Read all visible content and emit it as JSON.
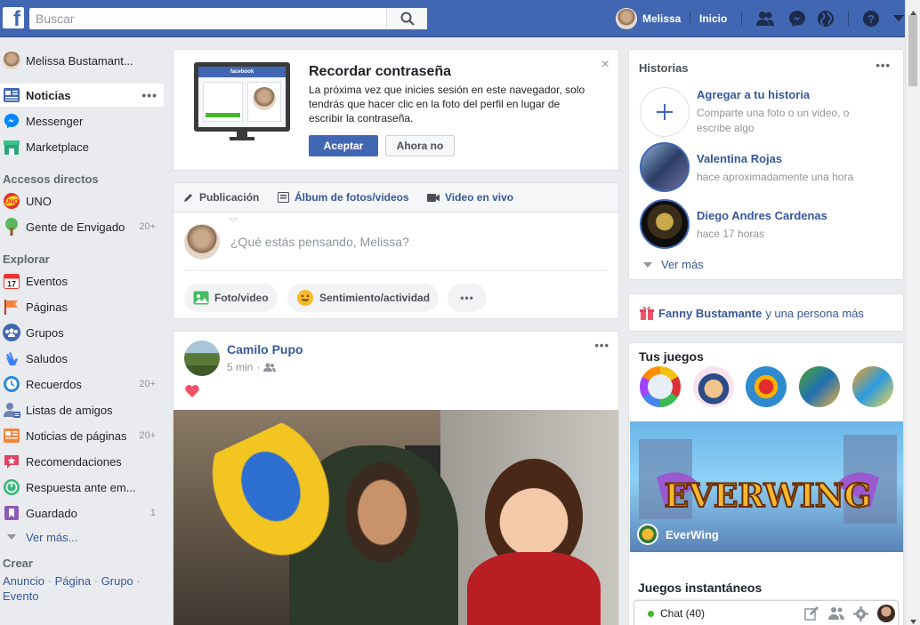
{
  "topbar": {
    "search_placeholder": "Buscar",
    "user_name": "Melissa",
    "home_label": "Inicio",
    "logo_letter": "f"
  },
  "sidebar": {
    "profile_name": "Melissa Bustamant...",
    "main_items": [
      {
        "label": "Noticias",
        "icon": "news-feed-icon"
      },
      {
        "label": "Messenger",
        "icon": "messenger-icon"
      },
      {
        "label": "Marketplace",
        "icon": "marketplace-icon"
      }
    ],
    "shortcuts_heading": "Accesos directos",
    "shortcuts": [
      {
        "label": "UNO",
        "icon": "uno-icon"
      },
      {
        "label": "Gente de Envigado",
        "count": "20+",
        "icon": "tree-icon"
      }
    ],
    "explore_heading": "Explorar",
    "explore": [
      {
        "label": "Eventos",
        "icon": "calendar-icon"
      },
      {
        "label": "Páginas",
        "icon": "flag-icon"
      },
      {
        "label": "Grupos",
        "icon": "groups-icon"
      },
      {
        "label": "Saludos",
        "icon": "wave-icon"
      },
      {
        "label": "Recuerdos",
        "count": "20+",
        "icon": "memories-icon"
      },
      {
        "label": "Listas de amigos",
        "icon": "friends-list-icon"
      },
      {
        "label": "Noticias de páginas",
        "count": "20+",
        "icon": "pages-feed-icon"
      },
      {
        "label": "Recomendaciones",
        "icon": "recommendations-icon"
      },
      {
        "label": "Respuesta ante em...",
        "icon": "crisis-response-icon"
      },
      {
        "label": "Guardado",
        "count": "1",
        "icon": "saved-icon"
      }
    ],
    "see_more": "Ver más...",
    "create_heading": "Crear",
    "create_links": [
      "Anuncio",
      "Página",
      "Grupo",
      "Evento"
    ],
    "create_sep": "·",
    "calendar_day": "17"
  },
  "reminder": {
    "title": "Recordar contraseña",
    "text": "La próxima vez que inicies sesión en este navegador, solo tendrás que hacer clic en la foto del perfil en lugar de escribir la contraseña.",
    "accept": "Aceptar",
    "decline": "Ahora no",
    "close": "×",
    "illustration_brand": "facebook"
  },
  "composer": {
    "tabs": [
      "Publicación",
      "Álbum de fotos/videos",
      "Video en vivo"
    ],
    "placeholder": "¿Qué estás pensando, Melissa?",
    "actions": [
      "Foto/video",
      "Sentimiento/actividad"
    ],
    "more": "•••"
  },
  "post": {
    "author": "Camilo Pupo",
    "time": "5 min",
    "separator": "·",
    "more": "•••"
  },
  "stories": {
    "title": "Historias",
    "more": "•••",
    "add_title": "Agregar a tu historia",
    "add_sub": "Comparte una foto o un video, o escribe algo",
    "items": [
      {
        "name": "Valentina Rojas",
        "time": "hace aproximadamente una hora"
      },
      {
        "name": "Diego Andres Cardenas",
        "time": "hace 17 horas"
      }
    ],
    "see_more": "Ver más"
  },
  "birthday": {
    "name": "Fanny Bustamante",
    "rest": "y una persona más"
  },
  "games": {
    "title": "Tus juegos",
    "featured": "EverWing",
    "featured_logo": "EVERWING",
    "instant_heading": "Juegos instantáneos"
  },
  "chat": {
    "label": "Chat (40)",
    "status_color": "#42b72a"
  },
  "colors": {
    "brand": "#4267b2",
    "link": "#385898"
  }
}
